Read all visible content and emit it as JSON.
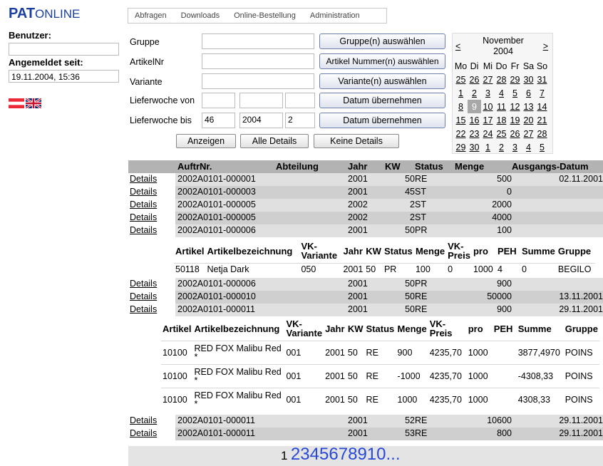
{
  "logo": {
    "pat": "PAT",
    "online": "ONLINE"
  },
  "sidebar": {
    "user_label": "Benutzer:",
    "user_value": "",
    "since_label": "Angemeldet seit:",
    "since_value": "19.11.2004, 15:36",
    "flags": [
      "flag-austria-icon",
      "flag-uk-icon"
    ]
  },
  "tabs": [
    "Abfragen",
    "Downloads",
    "Online-Bestellung",
    "Administration"
  ],
  "form": {
    "gruppe_label": "Gruppe",
    "artikelnr_label": "ArtikelNr",
    "variante_label": "Variante",
    "von_label": "Lieferwoche von",
    "bis_label": "Lieferwoche bis",
    "bis_week": "46",
    "bis_year": "2004",
    "bis_day": "2",
    "btn_gruppe": "Gruppe(n) auswählen",
    "btn_artikel": "Artikel Nummer(n) auswählen",
    "btn_variante": "Variante(n) auswählen",
    "btn_datum1": "Datum übernehmen",
    "btn_datum2": "Datum übernehmen",
    "btn_anzeigen": "Anzeigen",
    "btn_alle": "Alle Details",
    "btn_keine": "Keine Details"
  },
  "calendar": {
    "prev": "<",
    "next": ">",
    "month": "November",
    "year": "2004",
    "days": [
      "Mo",
      "Di",
      "Mi",
      "Do",
      "Fr",
      "Sa",
      "So"
    ],
    "weeks": [
      [
        "25",
        "26",
        "27",
        "28",
        "29",
        "30",
        "31"
      ],
      [
        "1",
        "2",
        "3",
        "4",
        "5",
        "6",
        "7"
      ],
      [
        "8",
        "9",
        "10",
        "11",
        "12",
        "13",
        "14"
      ],
      [
        "15",
        "16",
        "17",
        "18",
        "19",
        "20",
        "21"
      ],
      [
        "22",
        "23",
        "24",
        "25",
        "26",
        "27",
        "28"
      ],
      [
        "29",
        "30",
        "1",
        "2",
        "3",
        "4",
        "5"
      ]
    ],
    "selected": "9"
  },
  "table": {
    "headers": [
      "AuftrNr.",
      "Abteilung",
      "Jahr",
      "KW",
      "Status",
      "Menge",
      "Ausgangs-Datum"
    ],
    "details_label": "Details",
    "rows_a": [
      [
        "2002A0101-000001",
        "",
        "2001",
        "50",
        "RE",
        "500",
        "02.11.2001"
      ],
      [
        "2002A0101-000003",
        "",
        "2001",
        "45",
        "ST",
        "0",
        ""
      ],
      [
        "2002A0101-000005",
        "",
        "2002",
        "2",
        "ST",
        "2000",
        ""
      ],
      [
        "2002A0101-000005",
        "",
        "2002",
        "2",
        "ST",
        "4000",
        ""
      ],
      [
        "2002A0101-000006",
        "",
        "2001",
        "50",
        "PR",
        "100",
        ""
      ]
    ],
    "rows_b": [
      [
        "2002A0101-000006",
        "",
        "2001",
        "50",
        "PR",
        "900",
        ""
      ],
      [
        "2002A0101-000010",
        "",
        "2001",
        "50",
        "RE",
        "50000",
        "13.11.2001"
      ],
      [
        "2002A0101-000011",
        "",
        "2001",
        "50",
        "RE",
        "900",
        "29.11.2001"
      ]
    ],
    "rows_c": [
      [
        "2002A0101-000011",
        "",
        "2001",
        "52",
        "RE",
        "10600",
        "29.11.2001"
      ],
      [
        "2002A0101-000011",
        "",
        "2001",
        "53",
        "RE",
        "800",
        "29.11.2001"
      ]
    ]
  },
  "sub1": {
    "headers": [
      "Artikel",
      "Artikelbezeichnung",
      "VK-Variante",
      "Jahr",
      "KW",
      "Status",
      "Menge",
      "VK-Preis",
      "pro",
      "PEH",
      "Summe",
      "Gruppe"
    ],
    "rows": [
      [
        "50118",
        "Netja Dark",
        "050",
        "2001",
        "50",
        "PR",
        "100",
        "0",
        "1000",
        "4",
        "0",
        "BEGILO"
      ]
    ]
  },
  "sub2": {
    "headers": [
      "Artikel",
      "Artikelbezeichnung",
      "VK-Variante",
      "Jahr",
      "KW",
      "Status",
      "Menge",
      "VK-Preis",
      "pro",
      "PEH",
      "Summe",
      "Gruppe"
    ],
    "rows": [
      [
        "10100",
        "RED FOX Malibu Red *",
        "001",
        "2001",
        "50",
        "RE",
        "900",
        "4235,70",
        "1000",
        "",
        "3877,4970",
        "POINS"
      ],
      [
        "10100",
        "RED FOX Malibu Red *",
        "001",
        "2001",
        "50",
        "RE",
        "-1000",
        "4235,70",
        "1000",
        "",
        "-4308,33",
        "POINS"
      ],
      [
        "10100",
        "RED FOX Malibu Red *",
        "001",
        "2001",
        "50",
        "RE",
        "1000",
        "4235,70",
        "1000",
        "",
        "4308,33",
        "POINS"
      ]
    ]
  },
  "pager": {
    "current": "1",
    "pages": [
      "2",
      "3",
      "4",
      "5",
      "6",
      "7",
      "8",
      "9",
      "10",
      "..."
    ]
  }
}
